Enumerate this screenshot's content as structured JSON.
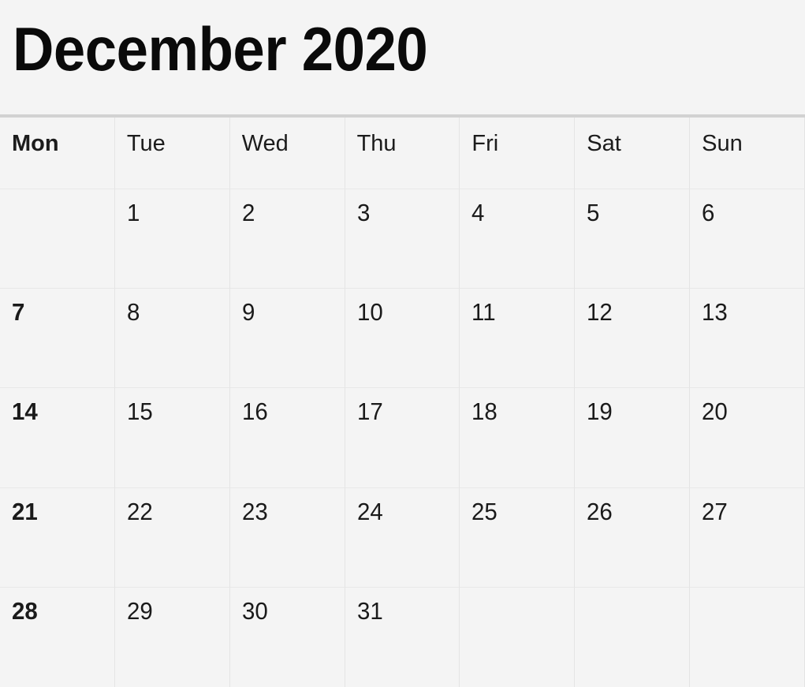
{
  "calendar": {
    "title": "December 2020",
    "month": "December",
    "year": "2020",
    "week_start": "Mon",
    "day_headers": [
      {
        "label": "Mon",
        "bold": true
      },
      {
        "label": "Tue",
        "bold": false
      },
      {
        "label": "Wed",
        "bold": false
      },
      {
        "label": "Thu",
        "bold": false
      },
      {
        "label": "Fri",
        "bold": false
      },
      {
        "label": "Sat",
        "bold": false
      },
      {
        "label": "Sun",
        "bold": false
      }
    ],
    "weeks": [
      [
        {
          "day": "",
          "bold": false
        },
        {
          "day": "1",
          "bold": false
        },
        {
          "day": "2",
          "bold": false
        },
        {
          "day": "3",
          "bold": false
        },
        {
          "day": "4",
          "bold": false
        },
        {
          "day": "5",
          "bold": false
        },
        {
          "day": "6",
          "bold": false
        }
      ],
      [
        {
          "day": "7",
          "bold": true
        },
        {
          "day": "8",
          "bold": false
        },
        {
          "day": "9",
          "bold": false
        },
        {
          "day": "10",
          "bold": false
        },
        {
          "day": "11",
          "bold": false
        },
        {
          "day": "12",
          "bold": false
        },
        {
          "day": "13",
          "bold": false
        }
      ],
      [
        {
          "day": "14",
          "bold": true
        },
        {
          "day": "15",
          "bold": false
        },
        {
          "day": "16",
          "bold": false
        },
        {
          "day": "17",
          "bold": false
        },
        {
          "day": "18",
          "bold": false
        },
        {
          "day": "19",
          "bold": false
        },
        {
          "day": "20",
          "bold": false
        }
      ],
      [
        {
          "day": "21",
          "bold": true
        },
        {
          "day": "22",
          "bold": false
        },
        {
          "day": "23",
          "bold": false
        },
        {
          "day": "24",
          "bold": false
        },
        {
          "day": "25",
          "bold": false
        },
        {
          "day": "26",
          "bold": false
        },
        {
          "day": "27",
          "bold": false
        }
      ],
      [
        {
          "day": "28",
          "bold": true
        },
        {
          "day": "29",
          "bold": false
        },
        {
          "day": "30",
          "bold": false
        },
        {
          "day": "31",
          "bold": false
        },
        {
          "day": "",
          "bold": false
        },
        {
          "day": "",
          "bold": false
        },
        {
          "day": "",
          "bold": false
        }
      ]
    ],
    "colors": {
      "background": "#f4f4f4",
      "text": "#1a1a1a",
      "title_text": "#0a0a0a",
      "grid_line": "#e4e4e4",
      "title_divider": "#d2d2d2"
    }
  }
}
